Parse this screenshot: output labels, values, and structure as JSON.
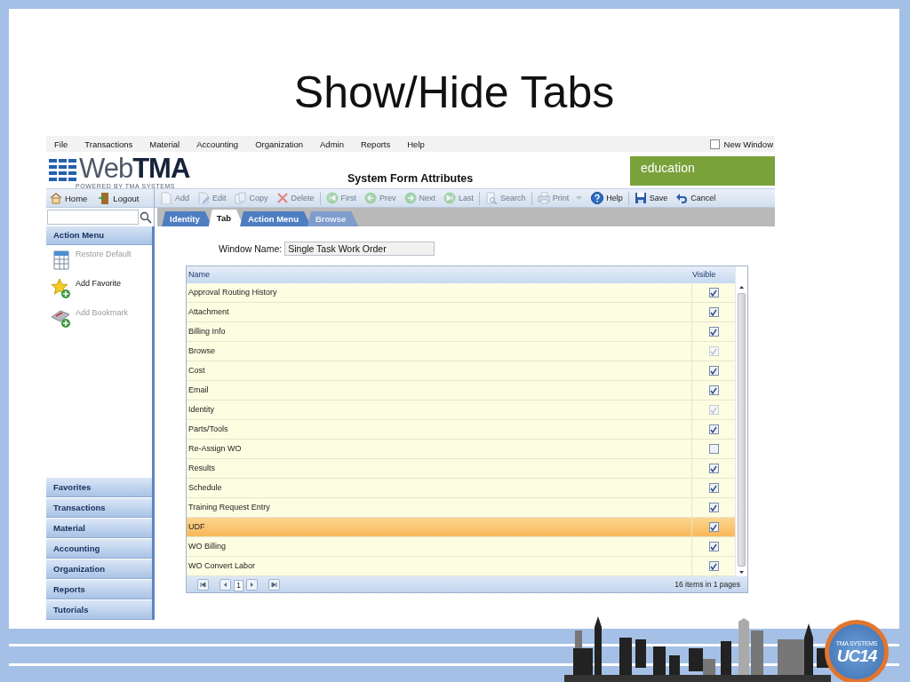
{
  "slide": {
    "title": "Show/Hide Tabs"
  },
  "menu_bar": {
    "items": [
      "File",
      "Transactions",
      "Material",
      "Accounting",
      "Organization",
      "Admin",
      "Reports",
      "Help"
    ],
    "new_window": {
      "label": "New Window",
      "checked": false
    }
  },
  "header": {
    "logo_light": "Web",
    "logo_bold": "TMA",
    "logo_tagline": "POWERED BY TMA SYSTEMS",
    "form_title": "System Form Attributes",
    "banner": "education"
  },
  "nav_buttons": [
    {
      "label": "Home"
    },
    {
      "label": "Logout"
    }
  ],
  "toolbar": [
    {
      "label": "Add",
      "disabled": true,
      "separator_after": false
    },
    {
      "label": "Edit",
      "disabled": true,
      "separator_after": false
    },
    {
      "label": "Copy",
      "disabled": true,
      "separator_after": false
    },
    {
      "label": "Delete",
      "disabled": true,
      "separator_after": true
    },
    {
      "label": "First",
      "disabled": true,
      "separator_after": false
    },
    {
      "label": "Prev",
      "disabled": true,
      "separator_after": false
    },
    {
      "label": "Next",
      "disabled": true,
      "separator_after": false
    },
    {
      "label": "Last",
      "disabled": true,
      "separator_after": true
    },
    {
      "label": "Search",
      "disabled": true,
      "separator_after": true
    },
    {
      "label": "Print",
      "disabled": true,
      "separator_after": false
    },
    {
      "label": "Help",
      "disabled": false,
      "separator_after": true
    },
    {
      "label": "Save",
      "disabled": false,
      "separator_after": false
    },
    {
      "label": "Cancel",
      "disabled": false,
      "separator_after": false
    }
  ],
  "tabs": [
    {
      "label": "Identity",
      "selected": false,
      "disabled": false
    },
    {
      "label": "Tab",
      "selected": true,
      "disabled": false
    },
    {
      "label": "Action Menu",
      "selected": false,
      "disabled": false
    },
    {
      "label": "Browse",
      "selected": false,
      "disabled": true
    }
  ],
  "sidebar": {
    "header": "Action Menu",
    "actions": [
      {
        "label": "Restore Default",
        "disabled": true
      },
      {
        "label": "Add Favorite",
        "disabled": false
      },
      {
        "label": "Add Bookmark",
        "disabled": true
      }
    ],
    "sections": [
      "Favorites",
      "Transactions",
      "Material",
      "Accounting",
      "Organization",
      "Reports",
      "Tutorials"
    ]
  },
  "form": {
    "window_name_label": "Window Name:",
    "window_name_value": "Single Task Work Order"
  },
  "grid": {
    "columns": [
      "Name",
      "Visible"
    ],
    "rows": [
      {
        "name": "Approval Routing History",
        "visible": true,
        "disabled": false,
        "selected": false
      },
      {
        "name": "Attachment",
        "visible": true,
        "disabled": false,
        "selected": false
      },
      {
        "name": "Billing Info",
        "visible": true,
        "disabled": false,
        "selected": false
      },
      {
        "name": "Browse",
        "visible": true,
        "disabled": true,
        "selected": false
      },
      {
        "name": "Cost",
        "visible": true,
        "disabled": false,
        "selected": false
      },
      {
        "name": "Email",
        "visible": true,
        "disabled": false,
        "selected": false
      },
      {
        "name": "Identity",
        "visible": true,
        "disabled": true,
        "selected": false
      },
      {
        "name": "Parts/Tools",
        "visible": true,
        "disabled": false,
        "selected": false
      },
      {
        "name": "Re-Assign WO",
        "visible": false,
        "disabled": false,
        "selected": false
      },
      {
        "name": "Results",
        "visible": true,
        "disabled": false,
        "selected": false
      },
      {
        "name": "Schedule",
        "visible": true,
        "disabled": false,
        "selected": false
      },
      {
        "name": "Training Request Entry",
        "visible": true,
        "disabled": false,
        "selected": false
      },
      {
        "name": "UDF",
        "visible": true,
        "disabled": false,
        "selected": true
      },
      {
        "name": "WO Billing",
        "visible": true,
        "disabled": false,
        "selected": false
      },
      {
        "name": "WO Convert Labor",
        "visible": true,
        "disabled": false,
        "selected": false
      }
    ],
    "pager": {
      "page": "1",
      "summary": "16 items in 1 pages"
    }
  },
  "footer": {
    "badge_tagline": "TMA SYSTEMS",
    "badge_text": "UC14"
  }
}
